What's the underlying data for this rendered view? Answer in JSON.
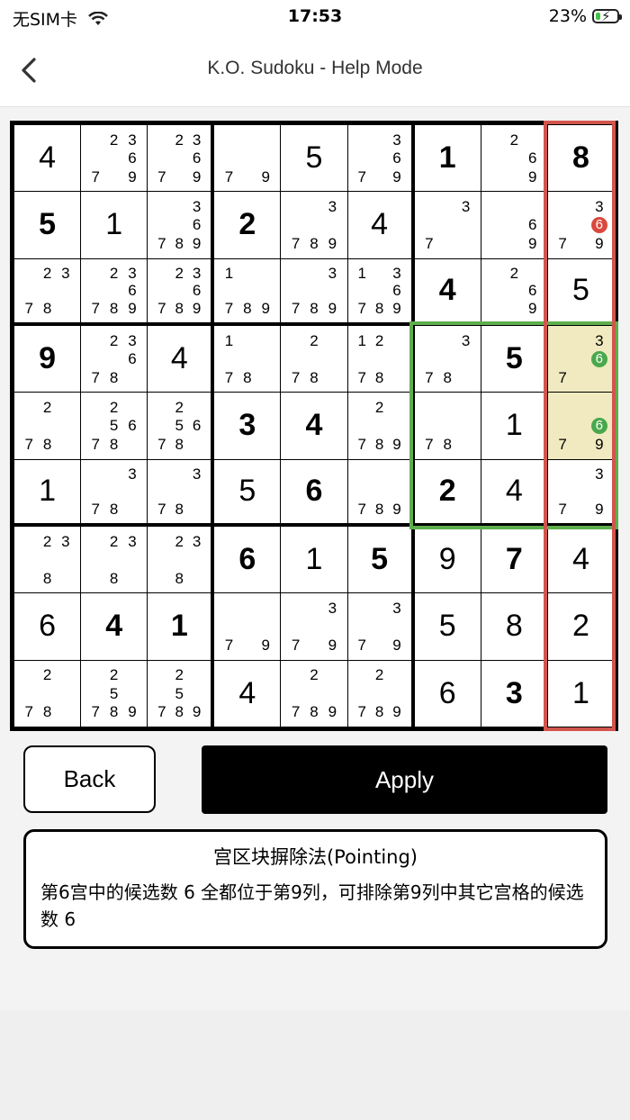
{
  "status_bar": {
    "carrier": "无SIM卡",
    "time": "17:53",
    "battery": "23%",
    "battery_level": 0.23
  },
  "nav": {
    "title": "K.O. Sudoku - Help Mode",
    "back_icon": "chevron-left-icon"
  },
  "board": {
    "cells": [
      [
        {
          "v": "4"
        },
        {
          "c": [
            "",
            "2",
            "3",
            "",
            "",
            "6",
            "7",
            "",
            "9"
          ]
        },
        {
          "c": [
            "",
            "2",
            "3",
            "",
            "",
            "6",
            "7",
            "",
            "9"
          ]
        },
        {
          "c": [
            "",
            "",
            "",
            "",
            "",
            "",
            "7",
            "",
            "9"
          ]
        },
        {
          "v": "5"
        },
        {
          "c": [
            "",
            "",
            "3",
            "",
            "",
            "6",
            "7",
            "",
            "9"
          ]
        },
        {
          "v": "1",
          "g": true
        },
        {
          "c": [
            "",
            "2",
            "",
            "",
            "",
            "6",
            "",
            "",
            "9"
          ]
        },
        {
          "v": "8",
          "g": true
        }
      ],
      [
        {
          "v": "5",
          "g": true
        },
        {
          "v": "1"
        },
        {
          "c": [
            "",
            "",
            "3",
            "",
            "",
            "6",
            "7",
            "8",
            "9"
          ]
        },
        {
          "v": "2",
          "g": true
        },
        {
          "c": [
            "",
            "",
            "3",
            "",
            "",
            "",
            "7",
            "8",
            "9"
          ]
        },
        {
          "v": "4"
        },
        {
          "c": [
            "",
            "",
            "3",
            "",
            "",
            "",
            "7",
            "",
            ""
          ]
        },
        {
          "c": [
            "",
            "",
            "",
            "",
            "",
            "6",
            "",
            "",
            "9"
          ]
        },
        {
          "c": [
            "",
            "",
            "3",
            "",
            "",
            "6r",
            "7",
            "",
            "9"
          ]
        }
      ],
      [
        {
          "c": [
            "",
            "2",
            "3",
            "",
            "",
            "",
            "7",
            "8",
            ""
          ]
        },
        {
          "c": [
            "",
            "2",
            "3",
            "",
            "",
            "6",
            "7",
            "8",
            "9"
          ]
        },
        {
          "c": [
            "",
            "2",
            "3",
            "",
            "",
            "6",
            "7",
            "8",
            "9"
          ]
        },
        {
          "c": [
            "1",
            "",
            "",
            "",
            "",
            "",
            "7",
            "8",
            "9"
          ]
        },
        {
          "c": [
            "",
            "",
            "3",
            "",
            "",
            "",
            "7",
            "8",
            "9"
          ]
        },
        {
          "c": [
            "1",
            "",
            "3",
            "",
            "",
            "6",
            "7",
            "8",
            "9"
          ]
        },
        {
          "v": "4",
          "g": true
        },
        {
          "c": [
            "",
            "2",
            "",
            "",
            "",
            "6",
            "",
            "",
            "9"
          ]
        },
        {
          "v": "5"
        }
      ],
      [
        {
          "v": "9",
          "g": true
        },
        {
          "c": [
            "",
            "2",
            "3",
            "",
            "",
            "6",
            "7",
            "8",
            ""
          ]
        },
        {
          "v": "4"
        },
        {
          "c": [
            "1",
            "",
            "",
            "",
            "",
            "",
            "7",
            "8",
            ""
          ]
        },
        {
          "c": [
            "",
            "2",
            "",
            "",
            "",
            "",
            "7",
            "8",
            ""
          ]
        },
        {
          "c": [
            "1",
            "2",
            "",
            "",
            "",
            "",
            "7",
            "8",
            ""
          ]
        },
        {
          "c": [
            "",
            "",
            "3",
            "",
            "",
            "",
            "7",
            "8",
            ""
          ]
        },
        {
          "v": "5",
          "g": true
        },
        {
          "c": [
            "",
            "",
            "3",
            "",
            "",
            "6g",
            "7",
            "",
            ""
          ],
          "hl": true
        }
      ],
      [
        {
          "c": [
            "",
            "2",
            "",
            "",
            "",
            "",
            "7",
            "8",
            ""
          ]
        },
        {
          "c": [
            "",
            "2",
            "",
            "",
            "5",
            "6",
            "7",
            "8",
            ""
          ]
        },
        {
          "c": [
            "",
            "2",
            "",
            "",
            "5",
            "6",
            "7",
            "8",
            ""
          ]
        },
        {
          "v": "3",
          "g": true
        },
        {
          "v": "4",
          "g": true
        },
        {
          "c": [
            "",
            "2",
            "",
            "",
            "",
            "",
            "7",
            "8",
            "9"
          ]
        },
        {
          "c": [
            "",
            "",
            "",
            "",
            "",
            "",
            "7",
            "8",
            ""
          ]
        },
        {
          "v": "1"
        },
        {
          "c": [
            "",
            "",
            "",
            "",
            "",
            "6g",
            "7",
            "",
            "9"
          ],
          "hl": true
        }
      ],
      [
        {
          "v": "1"
        },
        {
          "c": [
            "",
            "",
            "3",
            "",
            "",
            "",
            "7",
            "8",
            ""
          ]
        },
        {
          "c": [
            "",
            "",
            "3",
            "",
            "",
            "",
            "7",
            "8",
            ""
          ]
        },
        {
          "v": "5"
        },
        {
          "v": "6",
          "g": true
        },
        {
          "c": [
            "",
            "",
            "",
            "",
            "",
            "",
            "7",
            "8",
            "9"
          ]
        },
        {
          "v": "2",
          "g": true
        },
        {
          "v": "4"
        },
        {
          "c": [
            "",
            "",
            "3",
            "",
            "",
            "",
            "7",
            "",
            "9"
          ]
        }
      ],
      [
        {
          "c": [
            "",
            "2",
            "3",
            "",
            "",
            "",
            "",
            "8",
            ""
          ]
        },
        {
          "c": [
            "",
            "2",
            "3",
            "",
            "",
            "",
            "",
            "8",
            ""
          ]
        },
        {
          "c": [
            "",
            "2",
            "3",
            "",
            "",
            "",
            "",
            "8",
            ""
          ]
        },
        {
          "v": "6",
          "g": true
        },
        {
          "v": "1"
        },
        {
          "v": "5",
          "g": true
        },
        {
          "v": "9"
        },
        {
          "v": "7",
          "g": true
        },
        {
          "v": "4"
        }
      ],
      [
        {
          "v": "6"
        },
        {
          "v": "4",
          "g": true
        },
        {
          "v": "1",
          "g": true
        },
        {
          "c": [
            "",
            "",
            "",
            "",
            "",
            "",
            "7",
            "",
            "9"
          ]
        },
        {
          "c": [
            "",
            "",
            "3",
            "",
            "",
            "",
            "7",
            "",
            "9"
          ]
        },
        {
          "c": [
            "",
            "",
            "3",
            "",
            "",
            "",
            "7",
            "",
            "9"
          ]
        },
        {
          "v": "5"
        },
        {
          "v": "8"
        },
        {
          "v": "2"
        }
      ],
      [
        {
          "c": [
            "",
            "2",
            "",
            "",
            "",
            "",
            "7",
            "8",
            ""
          ]
        },
        {
          "c": [
            "",
            "2",
            "",
            "",
            "5",
            "",
            "7",
            "8",
            "9"
          ]
        },
        {
          "c": [
            "",
            "2",
            "",
            "",
            "5",
            "",
            "7",
            "8",
            "9"
          ]
        },
        {
          "v": "4"
        },
        {
          "c": [
            "",
            "2",
            "",
            "",
            "",
            "",
            "7",
            "8",
            "9"
          ]
        },
        {
          "c": [
            "",
            "2",
            "",
            "",
            "",
            "",
            "7",
            "8",
            "9"
          ]
        },
        {
          "v": "6"
        },
        {
          "v": "3",
          "g": true
        },
        {
          "v": "1"
        }
      ]
    ]
  },
  "buttons": {
    "back": "Back",
    "apply": "Apply"
  },
  "hint": {
    "title": "宫区块摒除法(Pointing)",
    "body": "第6宫中的候选数 6 全都位于第9列，可排除第9列中其它宫格的候选数 6"
  },
  "colors": {
    "highlight_column": "#d2554d",
    "highlight_box": "#5fae4d",
    "highlight_cell": "#f1eac0",
    "remove_candidate": "#d9493e",
    "keep_candidate": "#4aa84c"
  }
}
